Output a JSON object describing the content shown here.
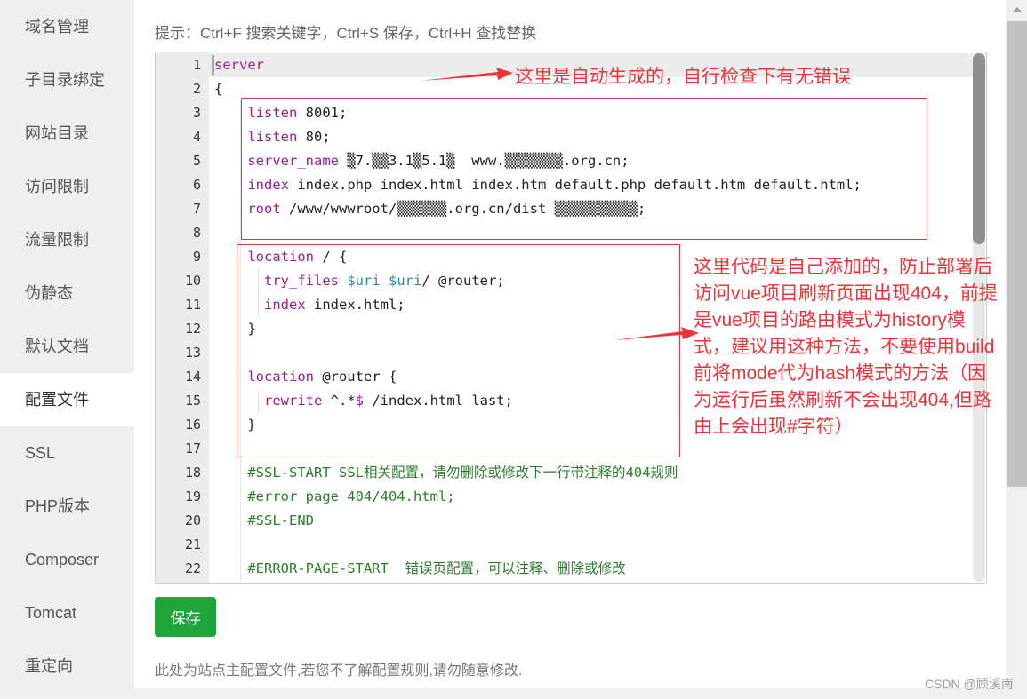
{
  "sidebar": {
    "items": [
      {
        "label": "域名管理",
        "active": false
      },
      {
        "label": "子目录绑定",
        "active": false
      },
      {
        "label": "网站目录",
        "active": false
      },
      {
        "label": "访问限制",
        "active": false
      },
      {
        "label": "流量限制",
        "active": false
      },
      {
        "label": "伪静态",
        "active": false
      },
      {
        "label": "默认文档",
        "active": false
      },
      {
        "label": "配置文件",
        "active": true
      },
      {
        "label": "SSL",
        "active": false
      },
      {
        "label": "PHP版本",
        "active": false
      },
      {
        "label": "Composer",
        "active": false
      },
      {
        "label": "Tomcat",
        "active": false
      },
      {
        "label": "重定向",
        "active": false
      }
    ]
  },
  "hint": "提示：Ctrl+F 搜索关键字，Ctrl+S 保存，Ctrl+H 查找替换",
  "editor": {
    "current_line": 1,
    "lines": [
      {
        "n": "1",
        "tokens": [
          {
            "t": "server",
            "c": "kw"
          }
        ]
      },
      {
        "n": "2",
        "tokens": [
          {
            "t": "{",
            "c": ""
          }
        ]
      },
      {
        "n": "3",
        "tokens": [
          {
            "t": "    listen",
            "c": "kw"
          },
          {
            "t": " 8001;",
            "c": ""
          }
        ]
      },
      {
        "n": "4",
        "tokens": [
          {
            "t": "    listen",
            "c": "kw"
          },
          {
            "t": " 80;",
            "c": ""
          }
        ]
      },
      {
        "n": "5",
        "tokens": [
          {
            "t": "    server_name",
            "c": "kw"
          },
          {
            "t": " ▒7.▒▒3.1▒5.1▒  www.▒▒▒▒▒▒▒.org.cn;",
            "c": ""
          }
        ]
      },
      {
        "n": "6",
        "tokens": [
          {
            "t": "    index",
            "c": "kw"
          },
          {
            "t": " index.php index.html index.htm default.php default.htm default.html;",
            "c": ""
          }
        ]
      },
      {
        "n": "7",
        "tokens": [
          {
            "t": "    root",
            "c": "kw"
          },
          {
            "t": " /www/wwwroot/▒▒▒▒▒▒.org.cn/dist ▒▒▒▒▒▒▒▒▒▒;",
            "c": ""
          }
        ]
      },
      {
        "n": "8",
        "tokens": []
      },
      {
        "n": "9",
        "tokens": [
          {
            "t": "    location",
            "c": "kw"
          },
          {
            "t": " / {",
            "c": ""
          }
        ]
      },
      {
        "n": "10",
        "tokens": [
          {
            "t": "      try_files",
            "c": "kw"
          },
          {
            "t": " ",
            "c": ""
          },
          {
            "t": "$uri",
            "c": "var"
          },
          {
            "t": " ",
            "c": ""
          },
          {
            "t": "$uri",
            "c": "var"
          },
          {
            "t": "/ @router;",
            "c": ""
          }
        ]
      },
      {
        "n": "11",
        "tokens": [
          {
            "t": "      index",
            "c": "kw"
          },
          {
            "t": " index.html;",
            "c": ""
          }
        ]
      },
      {
        "n": "12",
        "tokens": [
          {
            "t": "    }",
            "c": ""
          }
        ]
      },
      {
        "n": "13",
        "tokens": []
      },
      {
        "n": "14",
        "tokens": [
          {
            "t": "    location",
            "c": "kw"
          },
          {
            "t": " @router {",
            "c": ""
          }
        ]
      },
      {
        "n": "15",
        "tokens": [
          {
            "t": "      rewrite",
            "c": "kw"
          },
          {
            "t": " ^.*",
            "c": ""
          },
          {
            "t": "$",
            "c": "kw"
          },
          {
            "t": " /index.html last;",
            "c": ""
          }
        ]
      },
      {
        "n": "16",
        "tokens": [
          {
            "t": "    }",
            "c": ""
          }
        ]
      },
      {
        "n": "17",
        "tokens": []
      },
      {
        "n": "18",
        "tokens": [
          {
            "t": "    #SSL-START SSL相关配置，请勿删除或修改下一行带注释的404规则",
            "c": "cm"
          }
        ]
      },
      {
        "n": "19",
        "tokens": [
          {
            "t": "    #error_page 404/404.html;",
            "c": "cm"
          }
        ]
      },
      {
        "n": "20",
        "tokens": [
          {
            "t": "    #SSL-END",
            "c": "cm"
          }
        ]
      },
      {
        "n": "21",
        "tokens": []
      },
      {
        "n": "22",
        "tokens": [
          {
            "t": "    #ERROR-PAGE-START  错误页配置，可以注释、删除或修改",
            "c": "cm"
          }
        ]
      }
    ],
    "scroll_position_fraction": 0
  },
  "save_button": "保存",
  "footnote": "此处为站点主配置文件,若您不了解配置规则,请勿随意修改.",
  "annotations": {
    "top": "这里是自动生成的，自行检查下有无错误",
    "right_lines": [
      "这里代码是自己添加的，防止部署后",
      "访问vue项目刷新页面出现404，前提",
      "是vue项目的路由模式为history模",
      "式，建议用这种方法，不要使用build",
      "前将mode代为hash模式的方法（因",
      "为运行后虽然刷新不会出现404,但路",
      "由上会出现#字符）"
    ],
    "color": "#f0333a"
  },
  "watermark": "CSDN @顾溪南",
  "colors": {
    "save_button": "#20a53a",
    "keyword": "#9b1e8f",
    "variable": "#2a8aa0",
    "comment": "#2e7d2e"
  }
}
